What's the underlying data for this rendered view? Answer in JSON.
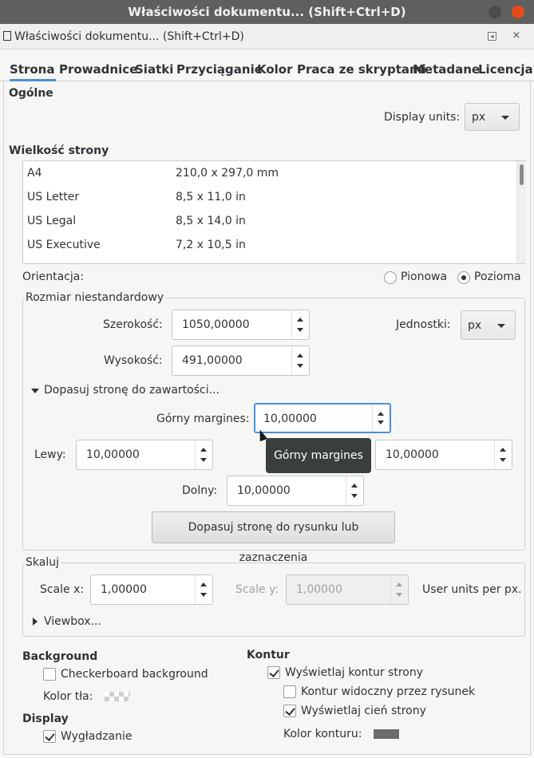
{
  "window": {
    "title": "Właściwości dokumentu... (Shift+Ctrl+D)",
    "btn_min_color": "#4b4b4b",
    "btn_close_color": "#e64a19"
  },
  "panel": {
    "title": "Właściwości dokumentu... (Shift+Ctrl+D)",
    "icon": "document-icon"
  },
  "tabs": [
    "Strona",
    "Prowadnice",
    "Siatki",
    "Przyciąganie",
    "Kolor",
    "Praca ze skryptami",
    "Metadane",
    "Licencja"
  ],
  "general": {
    "heading": "Ogólne",
    "display_units_label": "Display units:",
    "display_units_value": "px"
  },
  "page_size": {
    "heading": "Wielkość strony",
    "rows": [
      {
        "name": "A4",
        "size": "210,0 x 297,0 mm"
      },
      {
        "name": "US Letter",
        "size": "8,5 x 11,0 in"
      },
      {
        "name": "US Legal",
        "size": "8,5 x 14,0 in"
      },
      {
        "name": "US Executive",
        "size": "7,2 x 10,5 in"
      }
    ]
  },
  "orientation": {
    "label": "Orientacja:",
    "portrait": "Pionowa",
    "landscape": "Pozioma",
    "selected": "landscape"
  },
  "custom_size": {
    "legend": "Rozmiar niestandardowy",
    "width_label": "Szerokość:",
    "width_value": "1050,00000",
    "height_label": "Wysokość:",
    "height_value": "491,00000",
    "units_label": "Jednostki:",
    "units_value": "px",
    "fit_expander": "Dopasuj stronę do zawartości...",
    "top_label": "Górny margines:",
    "top_value": "10,00000",
    "left_label": "Lewy:",
    "left_value": "10,00000",
    "right_value": "10,00000",
    "bottom_label": "Dolny:",
    "bottom_value": "10,00000",
    "fit_button": "Dopasuj stronę do rysunku lub zaznaczenia",
    "tooltip": "Górny margines"
  },
  "scale": {
    "legend": "Skaluj",
    "scale_x_label": "Scale x:",
    "scale_x_value": "1,00000",
    "scale_y_label": "Scale y:",
    "scale_y_value": "1,00000",
    "user_units_label": "User units per px.",
    "viewbox_label": "Viewbox..."
  },
  "background": {
    "heading": "Background",
    "checkerboard_label": "Checkerboard background",
    "checkerboard_checked": false,
    "color_label": "Kolor tła:"
  },
  "display": {
    "heading": "Display",
    "antialias_label": "Wygładzanie",
    "antialias_checked": true
  },
  "border": {
    "heading": "Kontur",
    "show_border_label": "Wyświetlaj kontur strony",
    "show_border_checked": true,
    "on_top_label": "Kontur widoczny przez rysunek",
    "on_top_checked": false,
    "shadow_label": "Wyświetlaj cień strony",
    "shadow_checked": true,
    "color_label": "Kolor konturu:",
    "color": "#6b6b6b"
  }
}
